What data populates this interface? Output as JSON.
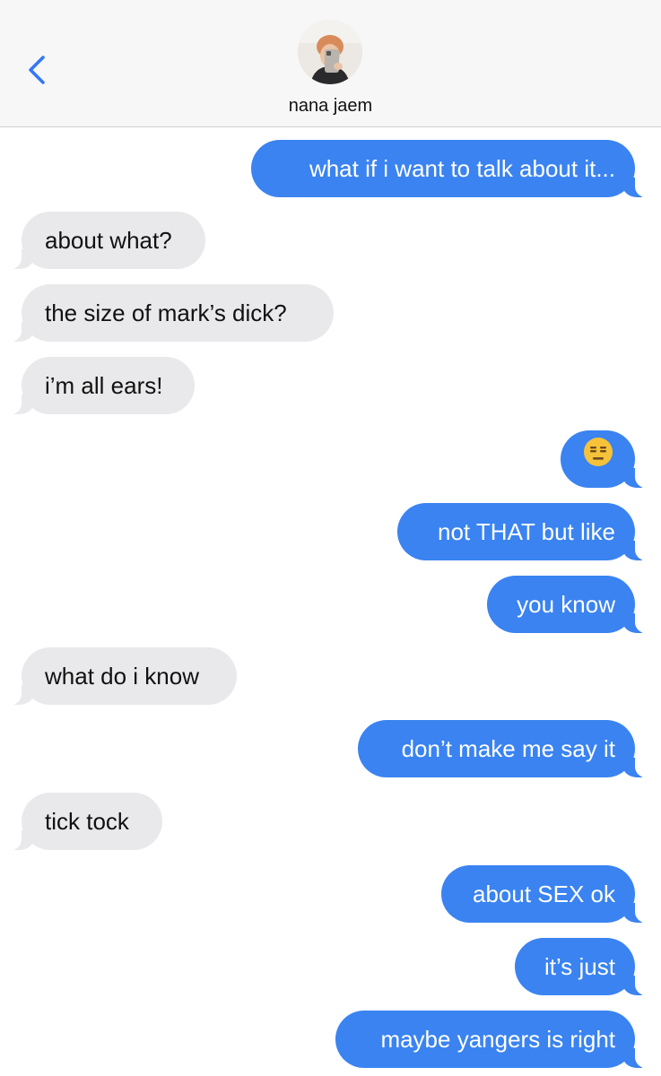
{
  "header": {
    "contact_name": "nana jaem",
    "back_icon": "chevron-left-icon",
    "avatar_icon": "contact-avatar-photo"
  },
  "colors": {
    "sent_bubble": "#3a83f1",
    "received_bubble": "#e9e9eb",
    "accent": "#3478f6"
  },
  "messages": [
    {
      "from": "me",
      "text": "what if i want to talk about it..."
    },
    {
      "from": "them",
      "text": "about what?"
    },
    {
      "from": "them",
      "text": "the size of mark’s dick?"
    },
    {
      "from": "them",
      "text": "i’m all ears!"
    },
    {
      "from": "me",
      "text": "😑",
      "emoji": "expressionless-face-emoji"
    },
    {
      "from": "me",
      "text": "not THAT but like"
    },
    {
      "from": "me",
      "text": "you know"
    },
    {
      "from": "them",
      "text": "what do i know"
    },
    {
      "from": "me",
      "text": "don’t make me say it"
    },
    {
      "from": "them",
      "text": "tick tock"
    },
    {
      "from": "me",
      "text": "about SEX ok"
    },
    {
      "from": "me",
      "text": "it’s just"
    },
    {
      "from": "me",
      "text": "maybe yangers is right"
    }
  ]
}
